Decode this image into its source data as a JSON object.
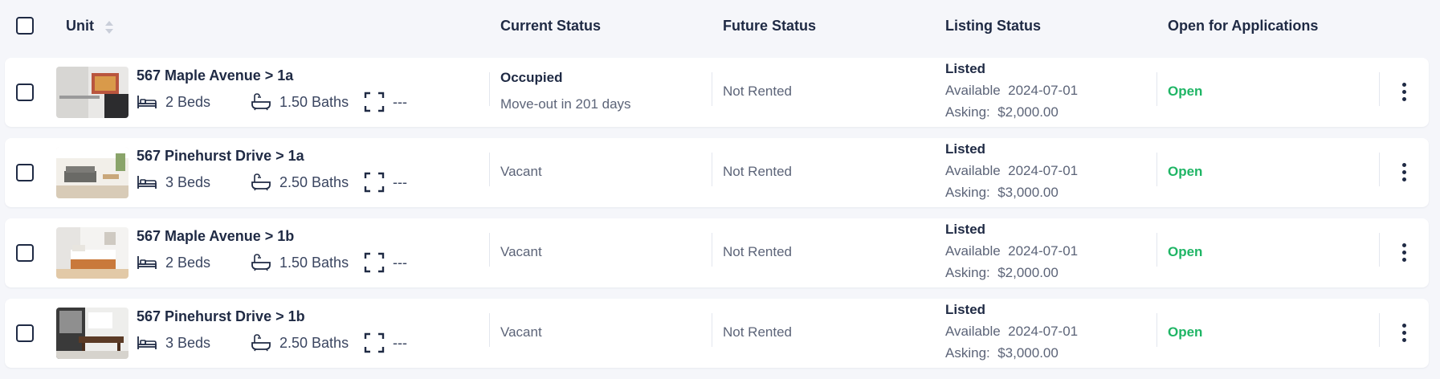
{
  "header": {
    "unit": "Unit",
    "current_status": "Current Status",
    "future_status": "Future Status",
    "listing_status": "Listing Status",
    "open_for_applications": "Open for Applications"
  },
  "rows": [
    {
      "title": "567 Maple Avenue > 1a",
      "beds": "2 Beds",
      "baths": "1.50 Baths",
      "size": "---",
      "current_status": "Occupied",
      "current_sub": "Move-out in 201 days",
      "future_status": "Not Rented",
      "listing": "Listed",
      "available_label": "Available",
      "available_date": "2024-07-01",
      "asking_label": "Asking:",
      "asking_value": "$2,000.00",
      "applications": "Open"
    },
    {
      "title": "567 Pinehurst Drive > 1a",
      "beds": "3 Beds",
      "baths": "2.50 Baths",
      "size": "---",
      "current_status": "Vacant",
      "future_status": "Not Rented",
      "listing": "Listed",
      "available_label": "Available",
      "available_date": "2024-07-01",
      "asking_label": "Asking:",
      "asking_value": "$3,000.00",
      "applications": "Open"
    },
    {
      "title": "567 Maple Avenue > 1b",
      "beds": "2 Beds",
      "baths": "1.50 Baths",
      "size": "---",
      "current_status": "Vacant",
      "future_status": "Not Rented",
      "listing": "Listed",
      "available_label": "Available",
      "available_date": "2024-07-01",
      "asking_label": "Asking:",
      "asking_value": "$2,000.00",
      "applications": "Open"
    },
    {
      "title": "567 Pinehurst Drive > 1b",
      "beds": "3 Beds",
      "baths": "2.50 Baths",
      "size": "---",
      "current_status": "Vacant",
      "future_status": "Not Rented",
      "listing": "Listed",
      "available_label": "Available",
      "available_date": "2024-07-01",
      "asking_label": "Asking:",
      "asking_value": "$3,000.00",
      "applications": "Open"
    }
  ],
  "colors": {
    "open": "#1fb565",
    "text": "#1f2a44",
    "muted": "#5c6478",
    "background": "#f5f6fa"
  },
  "icons": [
    "checkbox-icon",
    "sort-icon",
    "bed-icon",
    "bath-icon",
    "area-icon",
    "kebab-menu-icon"
  ]
}
